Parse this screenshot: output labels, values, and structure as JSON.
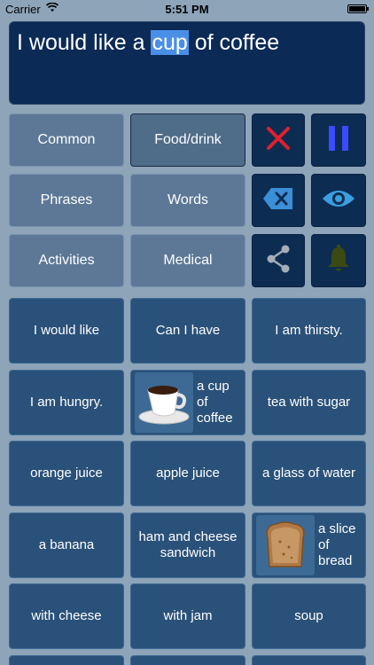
{
  "status_bar": {
    "carrier": "Carrier",
    "time": "5:51 PM",
    "wifi_icon": "wifi-icon",
    "battery_icon": "battery-icon"
  },
  "editor": {
    "text_before": "I would like a ",
    "selected_word": "cup",
    "text_after": " of coffee"
  },
  "categories": [
    {
      "label": "Common"
    },
    {
      "label": "Food/drink",
      "active": true
    },
    {
      "label": "Phrases"
    },
    {
      "label": "Words"
    },
    {
      "label": "Activities"
    },
    {
      "label": "Medical"
    }
  ],
  "controls": [
    {
      "icon": "clear-x-icon",
      "color": "#e0202c"
    },
    {
      "icon": "pause-icon",
      "color": "#3b4bff"
    },
    {
      "icon": "backspace-icon",
      "color": "#3a8fd8"
    },
    {
      "icon": "eye-icon",
      "color": "#3a9fe0"
    },
    {
      "icon": "share-icon",
      "color": "#a5adb6"
    },
    {
      "icon": "bell-icon",
      "color": "#3b4a12"
    }
  ],
  "phrases": [
    {
      "label": "I would like"
    },
    {
      "label": "Can I have"
    },
    {
      "label": "I am thirsty."
    },
    {
      "label": "I am hungry."
    },
    {
      "label": "a cup of coffee",
      "image": "coffee-cup-icon"
    },
    {
      "label": "tea with sugar"
    },
    {
      "label": "orange juice"
    },
    {
      "label": "apple juice"
    },
    {
      "label": "a glass of water"
    },
    {
      "label": "a banana"
    },
    {
      "label": "ham and cheese sandwich"
    },
    {
      "label": "a slice of bread",
      "image": "bread-slice-icon"
    },
    {
      "label": "with cheese"
    },
    {
      "label": "with jam"
    },
    {
      "label": "soup"
    }
  ]
}
